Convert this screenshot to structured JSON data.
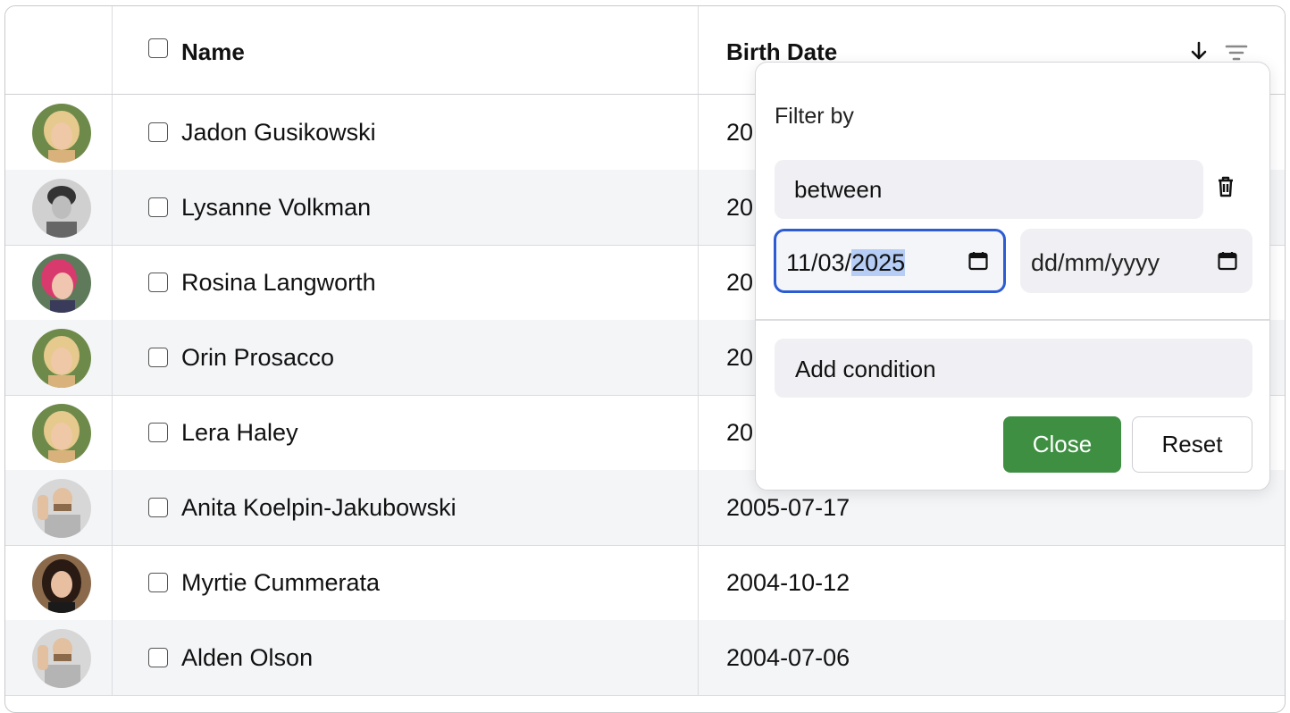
{
  "table": {
    "headers": {
      "name": "Name",
      "birth_date": "Birth Date"
    },
    "rows": [
      {
        "name": "Jadon Gusikowski",
        "birth_date": "20",
        "avatar": "blonde-woman-avatar"
      },
      {
        "name": "Lysanne Volkman",
        "birth_date": "20",
        "avatar": "bw-man-avatar"
      },
      {
        "name": "Rosina Langworth",
        "birth_date": "20",
        "avatar": "pink-hair-woman-avatar"
      },
      {
        "name": "Orin Prosacco",
        "birth_date": "20",
        "avatar": "blonde-woman-avatar"
      },
      {
        "name": "Lera Haley",
        "birth_date": "20",
        "avatar": "blonde-woman-avatar"
      },
      {
        "name": "Anita Koelpin-Jakubowski",
        "birth_date": "2005-07-17",
        "avatar": "bearded-man-avatar"
      },
      {
        "name": "Myrtie Cummerata",
        "birth_date": "2004-10-12",
        "avatar": "dark-hair-woman-avatar"
      },
      {
        "name": "Alden Olson",
        "birth_date": "2004-07-06",
        "avatar": "bearded-man-avatar"
      }
    ]
  },
  "filter_popover": {
    "title": "Filter by",
    "operator": "between",
    "from_date": {
      "prefix": "11/03/",
      "selected": "2025"
    },
    "to_date_placeholder": "dd/mm/yyyy",
    "add_condition_label": "Add condition",
    "close_label": "Close",
    "reset_label": "Reset"
  },
  "colors": {
    "accent_green": "#3f8f43",
    "focus_blue": "#2c5bd2",
    "row_alt": "#f4f5f7"
  },
  "icons": [
    "sort-down-icon",
    "filter-icon",
    "trash-icon",
    "calendar-icon",
    "checkbox-icon"
  ]
}
